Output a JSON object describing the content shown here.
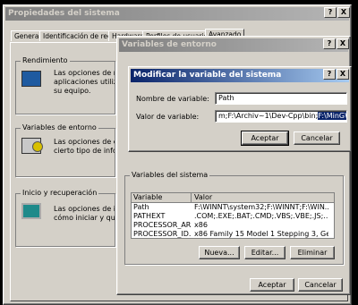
{
  "sys_props": {
    "title": "Propiedades del sistema",
    "tabs": [
      "General",
      "Identificación de red",
      "Hardware",
      "Perfiles de usuario",
      "Avanzado"
    ],
    "rendimiento": {
      "label": "Rendimiento",
      "text": [
        "Las opciones de rend",
        "aplicaciones utilizan l",
        "su equipo."
      ]
    },
    "entorno": {
      "label": "Variables de entorno",
      "text": [
        "Las opciones de ento",
        "cierto tipo de informa"
      ]
    },
    "inicio": {
      "label": "Inicio y recuperación",
      "text": [
        "Las opciones de inicio",
        "cómo iniciar y qué ha"
      ]
    }
  },
  "env_vars": {
    "title": "Variables de entorno",
    "system_group": "Variables del sistema",
    "columns": [
      "Variable",
      "Valor"
    ],
    "rows": [
      {
        "var": "Path",
        "val": "F:\\WINNT\\system32;F:\\WINNT;F:\\WIN..."
      },
      {
        "var": "PATHEXT",
        "val": ".COM;.EXE;.BAT;.CMD;.VBS;.VBE;.JS;...."
      },
      {
        "var": "PROCESSOR_AR...",
        "val": "x86"
      },
      {
        "var": "PROCESSOR_ID...",
        "val": "x86 Family 15 Model 1 Stepping 3, Genu..."
      }
    ],
    "buttons": {
      "new": "Nueva...",
      "edit": "Editar...",
      "delete": "Eliminar",
      "ok": "Aceptar",
      "cancel": "Cancelar"
    }
  },
  "edit_var": {
    "title": "Modificar la variable del sistema",
    "name_label": "Nombre de variable:",
    "name_value": "Path",
    "value_label": "Valor de variable:",
    "value_text": "m;F:\\Archiv~1\\Dev-Cpp\\bin;",
    "value_selected": "F:\\MinGW\\bin",
    "ok": "Aceptar",
    "cancel": "Cancelar"
  },
  "help_glyph": "?",
  "close_glyph": "X"
}
